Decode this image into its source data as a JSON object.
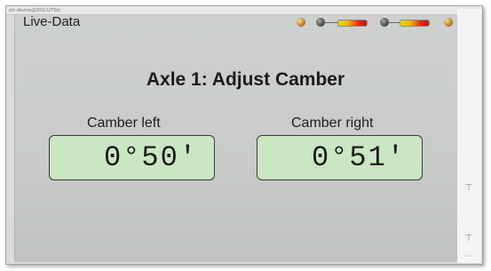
{
  "window": {
    "title_strip_text": "ptt-device@DSG-UTTab"
  },
  "app": {
    "name": "Live-Data"
  },
  "status_icons": [
    "sun-indicator-icon",
    "dark-indicator-icon",
    "battery-gauge-icon",
    "dark-indicator-icon",
    "battery-gauge-icon",
    "sun-indicator-icon"
  ],
  "main": {
    "heading": "Axle 1: Adjust Camber",
    "left": {
      "label": "Camber left",
      "value": "0°50'"
    },
    "right": {
      "label": "Camber right",
      "value": "0°51'"
    }
  },
  "colors": {
    "value_box_bg": "#cbe6c3",
    "panel_bg": "#cdd0ce"
  },
  "rail_buttons": [
    "pin-icon",
    "pin-icon",
    "more-icon"
  ]
}
